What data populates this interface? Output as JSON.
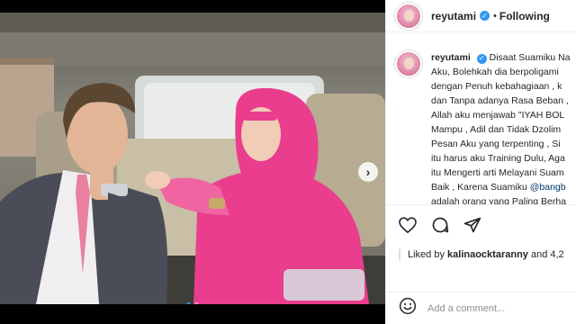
{
  "post": {
    "username": "reyutami",
    "follow_state": "Following",
    "separator": "•",
    "caption_lines": [
      {
        "text": "Disaat Suamiku Na",
        "lead": true
      },
      {
        "text": "Aku, Bolehkah dia berpoligami"
      },
      {
        "text": "dengan Penuh kebahagiaan , k"
      },
      {
        "text": "dan Tanpa adanya Rasa Beban ,"
      },
      {
        "text": "Allah aku menjawab \"IYAH BOL"
      },
      {
        "text": "Mampu , Adil dan Tidak Dzolim"
      },
      {
        "text": "Pesan Aku yang terpenting , Si"
      },
      {
        "text": "itu harus aku Training Dulu, Aga"
      },
      {
        "text": "itu Mengerti arti Melayani Suam"
      },
      {
        "text": "Baik , Karena Suamiku ",
        "mention": "@bangb"
      },
      {
        "text": "adalah orang yang Paling Berha"
      }
    ],
    "liked_by_prefix": "Liked by ",
    "liked_by_user": "kalinaocktaranny",
    "liked_by_suffix": " and 4,2",
    "comment_placeholder": "Add a comment...",
    "next_arrow": "›",
    "carousel": {
      "count": 2,
      "active": 0
    }
  },
  "icons": {
    "verified": "verified-badge-icon",
    "like": "heart-icon",
    "comment": "comment-bubble-icon",
    "share": "paper-plane-icon",
    "emoji": "smiley-icon",
    "next": "chevron-right-icon"
  },
  "colors": {
    "hijab": "#ea3d8d",
    "suit": "#4a4d57",
    "tie": "#e97fa1",
    "verified": "#3897f0",
    "active_dot": "#2196f3"
  }
}
